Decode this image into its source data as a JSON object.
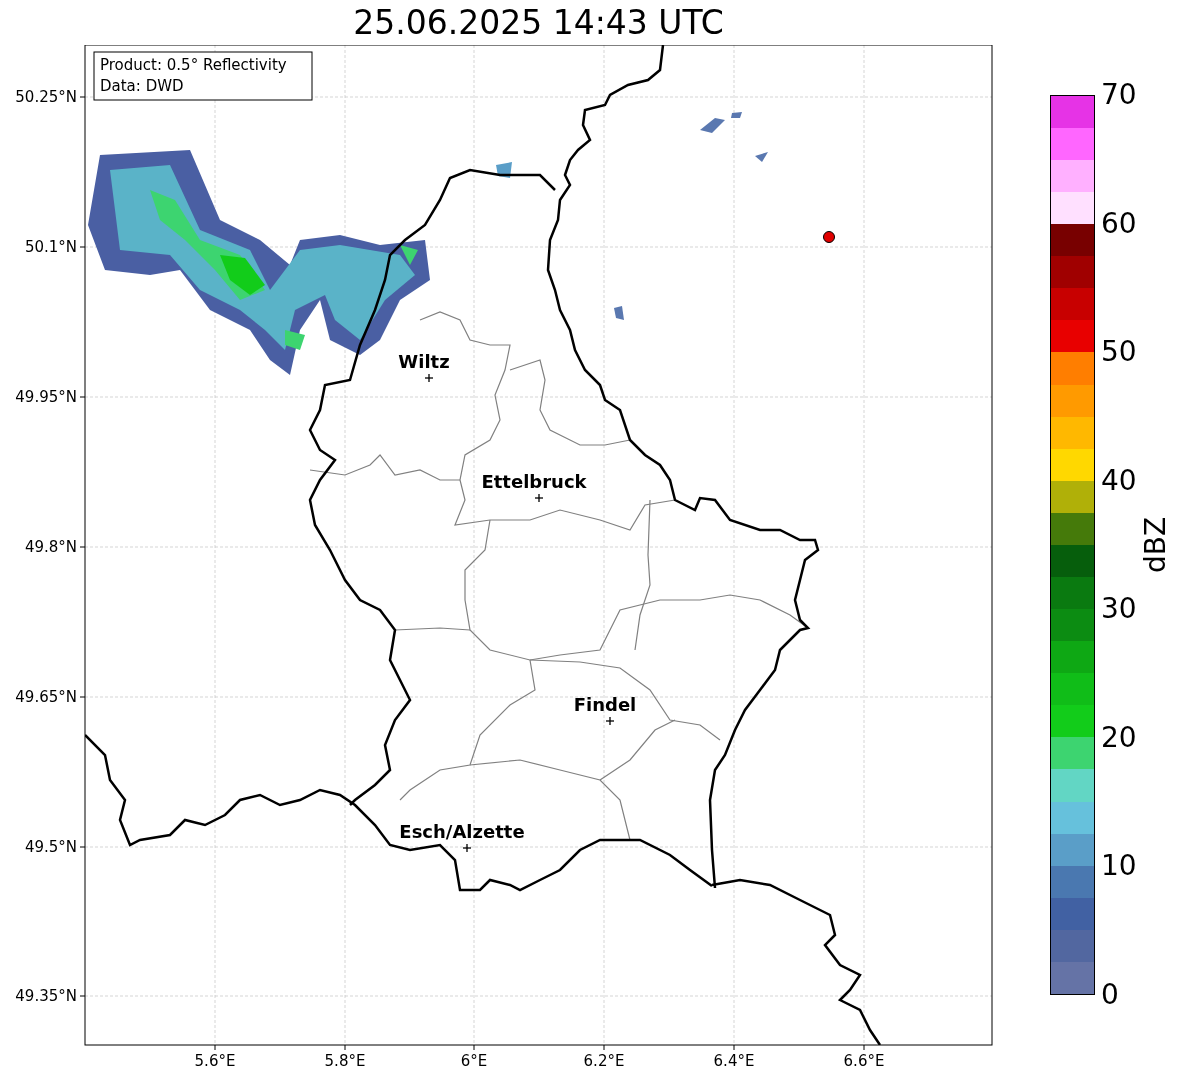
{
  "title": "25.06.2025 14:43 UTC",
  "info_box": {
    "lines": [
      "Product: 0.5° Reflectivity",
      "Data: DWD"
    ]
  },
  "map": {
    "lat_ticks": [
      "50.25°N",
      "50.1°N",
      "49.95°N",
      "49.8°N",
      "49.65°N",
      "49.5°N",
      "49.35°N"
    ],
    "lon_ticks": [
      "5.6°E",
      "5.8°E",
      "6°E",
      "6.2°E",
      "6.4°E",
      "6.6°E"
    ],
    "cities": [
      {
        "name": "Wiltz"
      },
      {
        "name": "Ettelbruck"
      },
      {
        "name": "Findel"
      },
      {
        "name": "Esch/Alzette"
      }
    ]
  },
  "colorbar": {
    "label": "dBZ",
    "ticks": [
      "70",
      "60",
      "50",
      "40",
      "30",
      "20",
      "10",
      "0"
    ]
  }
}
